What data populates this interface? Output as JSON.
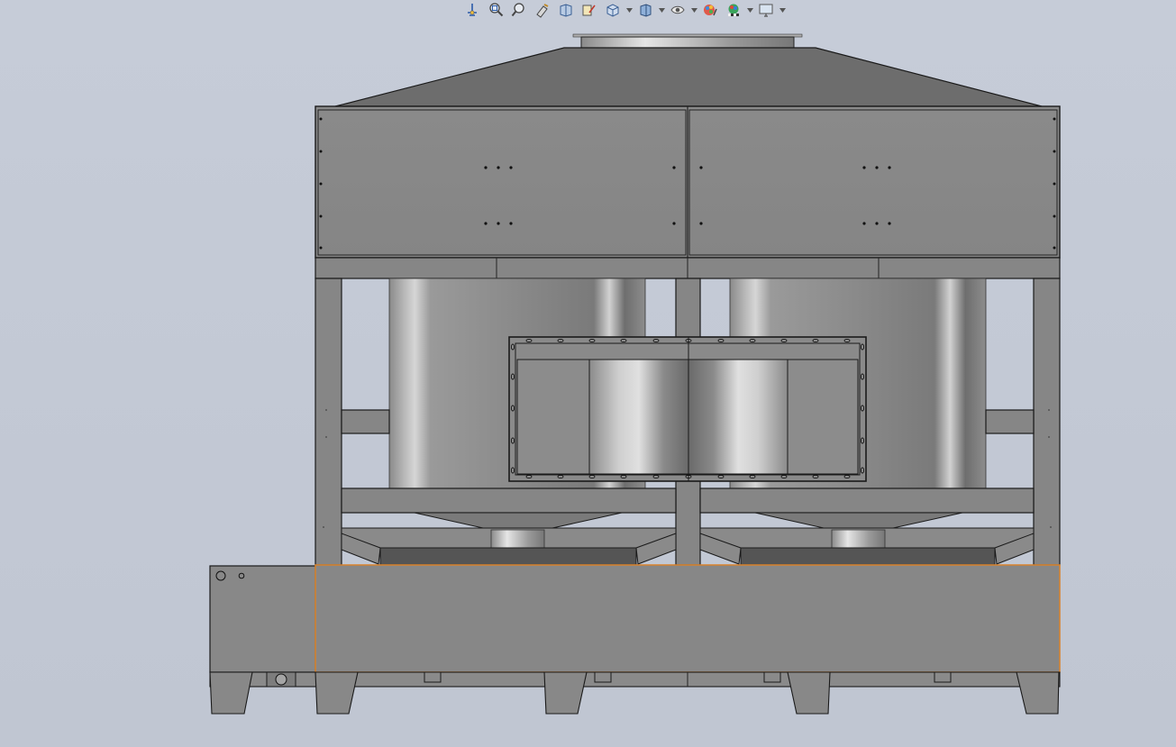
{
  "app": {
    "background_color": "#c3c9d5"
  },
  "toolbar": {
    "items": [
      {
        "icon": "normal-to-view-icon"
      },
      {
        "icon": "zoom-to-fit-icon"
      },
      {
        "icon": "zoom-to-area-icon"
      },
      {
        "icon": "previous-view-icon"
      },
      {
        "icon": "section-view-icon"
      },
      {
        "icon": "dynamic-annotation-icon"
      },
      {
        "icon": "view-orientation-icon",
        "dropdown": true
      },
      {
        "icon": "display-style-icon",
        "dropdown": true
      },
      {
        "icon": "hide-show-items-icon",
        "dropdown": true
      },
      {
        "icon": "edit-appearance-icon"
      },
      {
        "icon": "apply-scene-icon",
        "dropdown": true
      },
      {
        "icon": "view-settings-icon",
        "dropdown": true
      }
    ]
  },
  "model": {
    "name_visible": false,
    "selection_color": "#d9822b",
    "metal_color": "#868686",
    "edge_color": "#1a1a1a"
  }
}
